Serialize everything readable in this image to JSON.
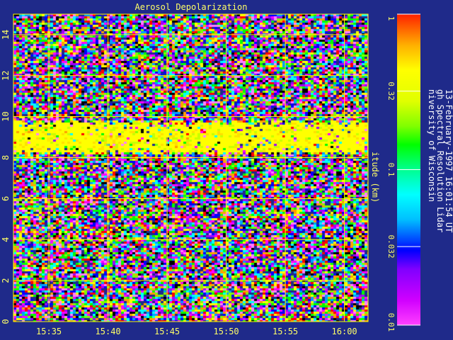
{
  "chart_data": {
    "type": "heatmap",
    "title": "Aerosol Depolarization",
    "ylabel": "itude (km)",
    "xlim": [
      "15:32",
      "16:02"
    ],
    "ylim": [
      0,
      15
    ],
    "x_ticks": [
      "15:35",
      "15:40",
      "15:45",
      "15:50",
      "15:55",
      "16:00"
    ],
    "y_ticks": [
      0,
      2,
      4,
      6,
      8,
      10,
      12,
      14
    ],
    "grid": true,
    "colorbar": {
      "scale": "log",
      "range": [
        0.01,
        1
      ],
      "ticks": [
        "0.01",
        "0.032",
        "0.1",
        "0.32",
        "1"
      ]
    },
    "features": [
      {
        "type": "high-depolarization layer",
        "altitude_km": [
          8.2,
          9.9
        ],
        "value_approx": 0.32
      }
    ],
    "side_text": [
      "niversity of Wisconsin",
      "gh Spectral Resolution Lidar",
      "13-February-1997 16:01:54 UT"
    ]
  },
  "colors": {
    "background": "#1f2a8a",
    "grid": "#ffff00",
    "text": "#ffff66"
  }
}
